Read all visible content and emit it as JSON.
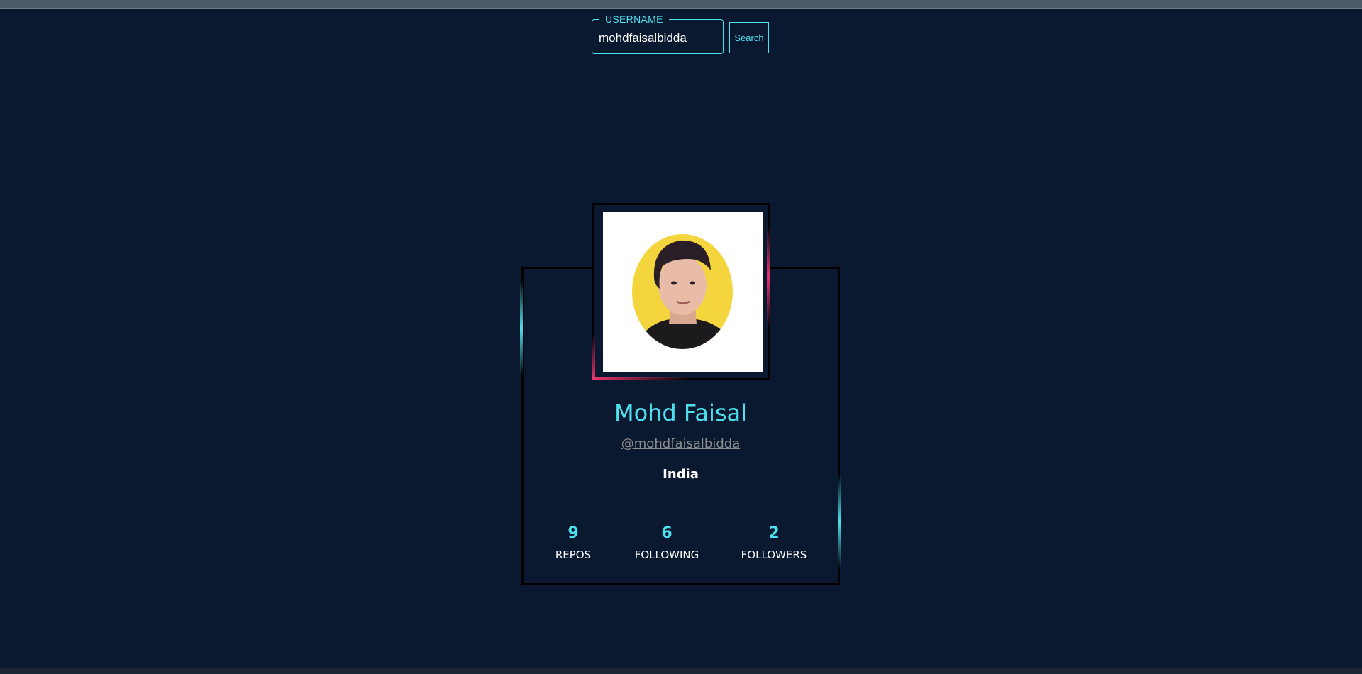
{
  "search": {
    "legend": "USERNAME",
    "value": "mohdfaisalbidda",
    "button_label": "Search"
  },
  "profile": {
    "name": "Mohd Faisal",
    "handle": "@mohdfaisalbidda",
    "location": "India",
    "stats": [
      {
        "value": "9",
        "label": "REPOS"
      },
      {
        "value": "6",
        "label": "FOLLOWING"
      },
      {
        "value": "2",
        "label": "FOLLOWERS"
      }
    ]
  },
  "colors": {
    "background": "#0a1830",
    "accent": "#4de0ee",
    "highlight": "#e8366e",
    "avatar_bg": "#f5d53e"
  }
}
